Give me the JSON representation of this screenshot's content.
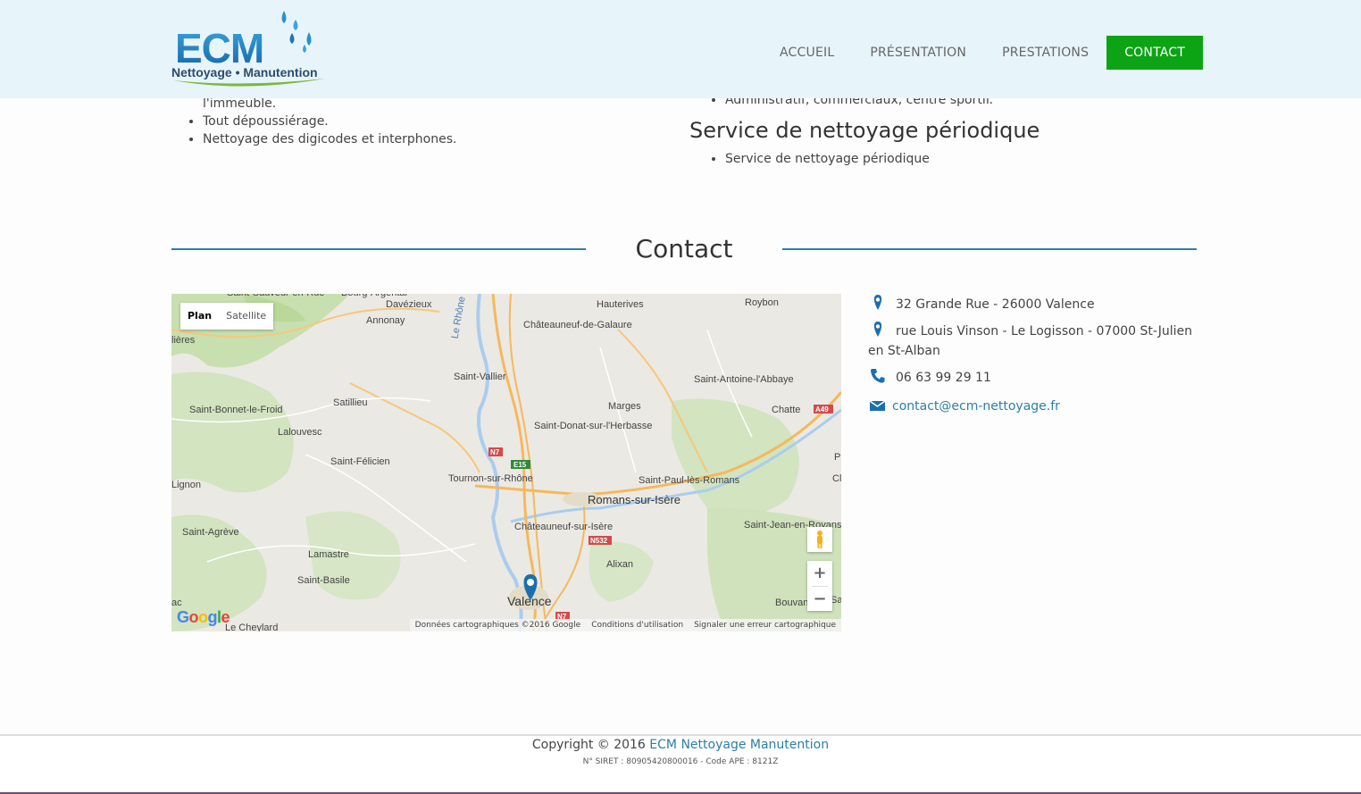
{
  "header": {
    "logo": {
      "title": "ECM",
      "subtitle": "Nettoyage • Manutention"
    },
    "nav": [
      {
        "label": "ACCUEIL"
      },
      {
        "label": "PRÉSENTATION"
      },
      {
        "label": "PRESTATIONS"
      },
      {
        "label": "CONTACT"
      }
    ]
  },
  "services": {
    "left_items": [
      "l'immeuble.",
      "Tout dépoussiérage.",
      "Nettoyage des digicodes et interphones."
    ],
    "right_item_top": "Administratif, commerciaux, centre sportif.",
    "periodic_heading": "Service de nettoyage périodique",
    "periodic_items": [
      "Service de nettoyage périodique"
    ]
  },
  "contact": {
    "title": "Contact",
    "address1": "32 Grande Rue - 26000 Valence",
    "address2": "rue Louis Vinson - Le Logisson - 07000 St-Julien en St-Alban",
    "phone": "06 63 99 29 11",
    "email": "contact@ecm-nettoyage.fr"
  },
  "map": {
    "toggle": [
      "Plan",
      "Satellite"
    ],
    "zoom_in": "+",
    "zoom_out": "−",
    "google_logo": "Google",
    "attribution": [
      "Données cartographiques ©2016 Google",
      "Conditions d'utilisation",
      "Signaler une erreur cartographique"
    ],
    "places": [
      "Saint-Sauveur-en-Rue",
      "Bourg-Argental",
      "Annonay",
      "Davézieux",
      "Hauterives",
      "Roybon",
      "Châteauneuf-de-Galaure",
      "Saint-Vallier",
      "Le Rhône",
      "Satillieu",
      "Saint-Bonnet-le-Froid",
      "Lalouvesc",
      "Marges",
      "Saint-Antoine-l'Abbaye",
      "Chatte",
      "Saint-Donat-sur-l'Herbasse",
      "Saint-Félicien",
      "Tournon-sur-Rhône",
      "Romans-sur-Isère",
      "Saint-Paul-lès-Romans",
      "Lignon",
      "Saint-Agrève",
      "Châteauneuf-sur-Isère",
      "Saint-Jean-en-Royans",
      "Lamastre",
      "Alixan",
      "Saint-Basile",
      "Valence",
      "Bouvant",
      "Le Cheylard",
      "lières",
      "Pl",
      "Cl",
      "Sa",
      "ac"
    ],
    "road_labels": [
      "N7",
      "E15",
      "N532",
      "A49",
      "N7"
    ]
  },
  "footer": {
    "copyright_prefix": "Copyright © 2016",
    "company": "ECM Nettoyage Manutention",
    "siret": "N° SIRET : 80905420800016 - Code APE : 8121Z"
  },
  "colors": {
    "header_bg": "#e7f4f9",
    "accent_green": "#0ca414",
    "accent_blue": "#2b7fa6"
  }
}
